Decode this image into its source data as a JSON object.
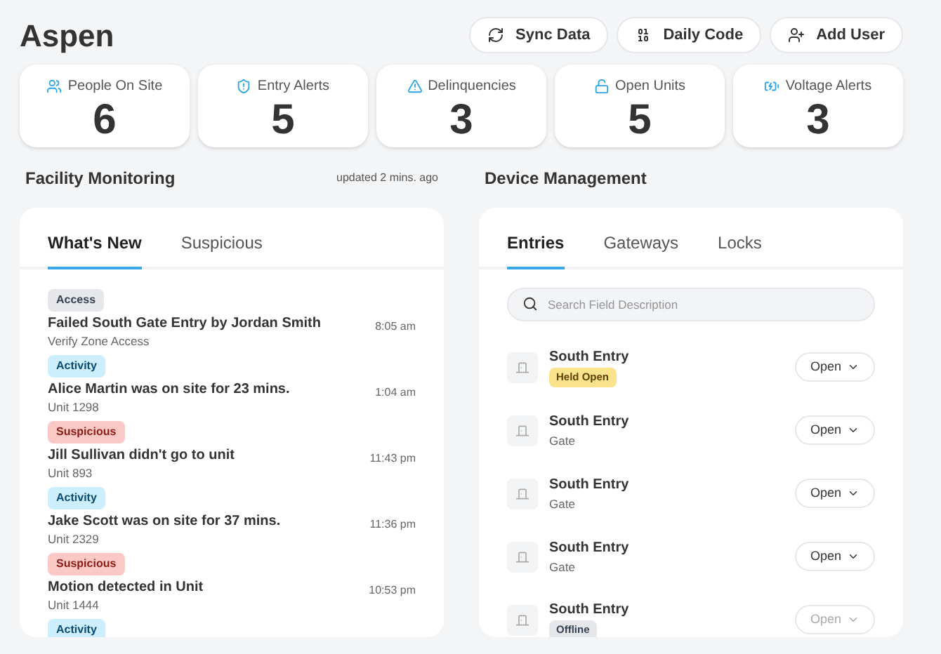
{
  "title": "Aspen",
  "actions": [
    "Sync Data",
    "Daily Code",
    "Add User"
  ],
  "stats": [
    {
      "label": "People On Site",
      "value": "6"
    },
    {
      "label": "Entry Alerts",
      "value": "5"
    },
    {
      "label": "Delinquencies",
      "value": "3"
    },
    {
      "label": "Open Units",
      "value": "5"
    },
    {
      "label": "Voltage Alerts",
      "value": "3"
    }
  ],
  "facility": {
    "title": "Facility Monitoring",
    "updated": "updated 2 mins. ago",
    "tabs": [
      {
        "label": "What's New",
        "selected": true
      },
      {
        "label": "Suspicious",
        "selected": false
      }
    ],
    "events": [
      {
        "tag": "Access",
        "kind": "access",
        "title": "Failed South Gate Entry by Jordan Smith",
        "detail": "Verify Zone Access",
        "time": "8:05 am"
      },
      {
        "tag": "Activity",
        "kind": "activity",
        "title": "Alice Martin was on site for 23 mins.",
        "detail": "Unit 1298",
        "time": "1:04 am"
      },
      {
        "tag": "Suspicious",
        "kind": "suspicious",
        "title": "Jill Sullivan didn't go to unit",
        "detail": "Unit 893",
        "time": "11:43 pm"
      },
      {
        "tag": "Activity",
        "kind": "activity",
        "title": "Jake Scott was on site for 37 mins.",
        "detail": "Unit 2329",
        "time": "11:36 pm"
      },
      {
        "tag": "Suspicious",
        "kind": "suspicious",
        "title": "Motion detected in Unit",
        "detail": "Unit 1444",
        "time": "10:53 pm"
      },
      {
        "tag": "Activity",
        "kind": "activity"
      }
    ]
  },
  "devices": {
    "title": "Device Management",
    "tabs": [
      {
        "label": "Entries",
        "selected": true
      },
      {
        "label": "Gateways",
        "selected": false
      },
      {
        "label": "Locks",
        "selected": false
      }
    ],
    "search": {
      "placeholder": "Search Field Description"
    },
    "entries": [
      {
        "name": "South Entry",
        "status": "Held Open",
        "kind": "held_open",
        "action": "Open",
        "disabled": false
      },
      {
        "name": "South Entry",
        "status": "Gate",
        "kind": "text",
        "action": "Open",
        "disabled": false
      },
      {
        "name": "South Entry",
        "status": "Gate",
        "kind": "text",
        "action": "Open",
        "disabled": false
      },
      {
        "name": "South Entry",
        "status": "Gate",
        "kind": "text",
        "action": "Open",
        "disabled": false
      },
      {
        "name": "South Entry",
        "status": "Offline",
        "kind": "offline",
        "action": "Open",
        "disabled": true
      }
    ]
  }
}
